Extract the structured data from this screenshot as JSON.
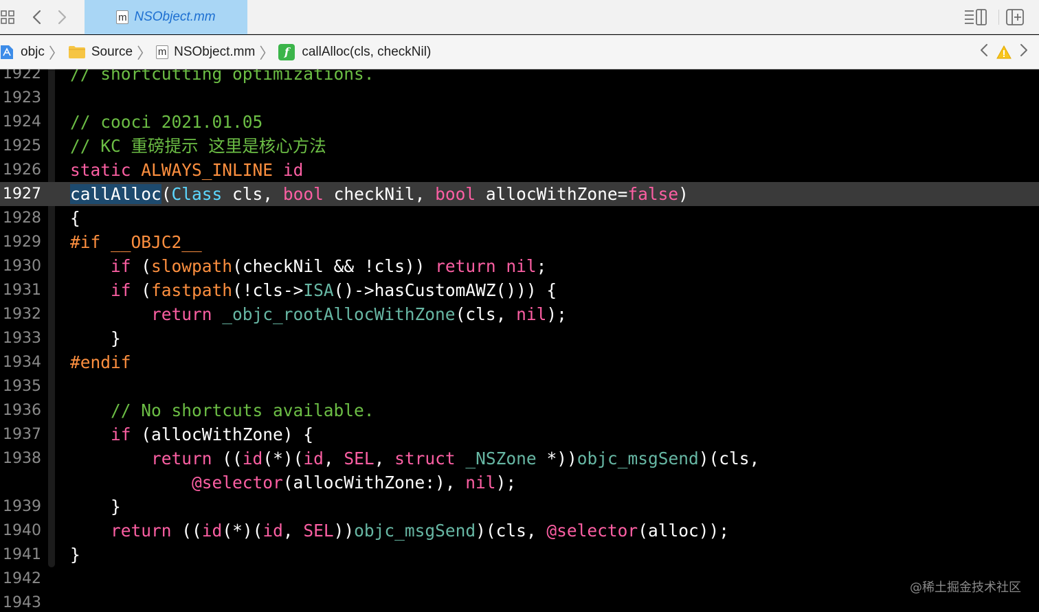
{
  "tab": {
    "label": "NSObject.mm",
    "file_badge": "m"
  },
  "breadcrumb": {
    "project": "objc",
    "folder": "Source",
    "file": "NSObject.mm",
    "file_badge": "m",
    "symbol": "callAlloc(cls, checkNil)",
    "symbol_badge": "f"
  },
  "colors": {
    "comment": "#6cbe45",
    "keyword": "#fc5fa3",
    "preprocessor": "#fd8f3f",
    "type": "#5dd8ff",
    "function": "#67b7a4"
  },
  "current_line": "1927",
  "lines": [
    {
      "num": "1922",
      "tokens": [
        [
          "cm",
          "// shortcutting optimizations."
        ]
      ]
    },
    {
      "num": "1923",
      "tokens": []
    },
    {
      "num": "1924",
      "tokens": [
        [
          "cm",
          "// cooci 2021.01.05"
        ]
      ]
    },
    {
      "num": "1925",
      "tokens": [
        [
          "cm",
          "// KC 重磅提示 这里是核心方法"
        ]
      ]
    },
    {
      "num": "1926",
      "tokens": [
        [
          "kw",
          "static"
        ],
        [
          "pl",
          " "
        ],
        [
          "pp",
          "ALWAYS_INLINE"
        ],
        [
          "pl",
          " "
        ],
        [
          "kw",
          "id"
        ]
      ]
    },
    {
      "num": "1927",
      "tokens": [
        [
          "hl",
          "callAlloc"
        ],
        [
          "pl",
          "("
        ],
        [
          "ty",
          "Class"
        ],
        [
          "pl",
          " cls, "
        ],
        [
          "kw",
          "bool"
        ],
        [
          "pl",
          " checkNil, "
        ],
        [
          "kw",
          "bool"
        ],
        [
          "pl",
          " allocWithZone="
        ],
        [
          "kw",
          "false"
        ],
        [
          "pl",
          ")"
        ]
      ]
    },
    {
      "num": "1928",
      "tokens": [
        [
          "pl",
          "{"
        ]
      ]
    },
    {
      "num": "1929",
      "tokens": [
        [
          "pp",
          "#if __OBJC2__"
        ]
      ]
    },
    {
      "num": "1930",
      "tokens": [
        [
          "pl",
          "    "
        ],
        [
          "kw",
          "if"
        ],
        [
          "pl",
          " ("
        ],
        [
          "pp",
          "slowpath"
        ],
        [
          "pl",
          "(checkNil && !cls)) "
        ],
        [
          "kw",
          "return"
        ],
        [
          "pl",
          " "
        ],
        [
          "kw",
          "nil"
        ],
        [
          "pl",
          ";"
        ]
      ]
    },
    {
      "num": "1931",
      "tokens": [
        [
          "pl",
          "    "
        ],
        [
          "kw",
          "if"
        ],
        [
          "pl",
          " ("
        ],
        [
          "pp",
          "fastpath"
        ],
        [
          "pl",
          "(!cls->"
        ],
        [
          "fn",
          "ISA"
        ],
        [
          "pl",
          "()->hasCustomAWZ())) {"
        ]
      ]
    },
    {
      "num": "1932",
      "tokens": [
        [
          "pl",
          "        "
        ],
        [
          "kw",
          "return"
        ],
        [
          "pl",
          " "
        ],
        [
          "fn",
          "_objc_rootAllocWithZone"
        ],
        [
          "pl",
          "(cls, "
        ],
        [
          "kw",
          "nil"
        ],
        [
          "pl",
          ");"
        ]
      ]
    },
    {
      "num": "1933",
      "tokens": [
        [
          "pl",
          "    }"
        ]
      ]
    },
    {
      "num": "1934",
      "tokens": [
        [
          "pp",
          "#endif"
        ]
      ]
    },
    {
      "num": "1935",
      "tokens": []
    },
    {
      "num": "1936",
      "tokens": [
        [
          "pl",
          "    "
        ],
        [
          "cm",
          "// No shortcuts available."
        ]
      ]
    },
    {
      "num": "1937",
      "tokens": [
        [
          "pl",
          "    "
        ],
        [
          "kw",
          "if"
        ],
        [
          "pl",
          " (allocWithZone) {"
        ]
      ]
    },
    {
      "num": "1938",
      "tokens": [
        [
          "pl",
          "        "
        ],
        [
          "kw",
          "return"
        ],
        [
          "pl",
          " (("
        ],
        [
          "kw",
          "id"
        ],
        [
          "pl",
          "(*)("
        ],
        [
          "kw",
          "id"
        ],
        [
          "pl",
          ", "
        ],
        [
          "kw",
          "SEL"
        ],
        [
          "pl",
          ", "
        ],
        [
          "kw",
          "struct"
        ],
        [
          "pl",
          " "
        ],
        [
          "fn",
          "_NSZone"
        ],
        [
          "pl",
          " *))"
        ],
        [
          "fn",
          "objc_msgSend"
        ],
        [
          "pl",
          ")(cls,"
        ]
      ]
    },
    {
      "num": "",
      "tokens": [
        [
          "pl",
          "            "
        ],
        [
          "kw",
          "@selector"
        ],
        [
          "pl",
          "(allocWithZone:), "
        ],
        [
          "kw",
          "nil"
        ],
        [
          "pl",
          ");"
        ]
      ]
    },
    {
      "num": "1939",
      "tokens": [
        [
          "pl",
          "    }"
        ]
      ]
    },
    {
      "num": "1940",
      "tokens": [
        [
          "pl",
          "    "
        ],
        [
          "kw",
          "return"
        ],
        [
          "pl",
          " (("
        ],
        [
          "kw",
          "id"
        ],
        [
          "pl",
          "(*)("
        ],
        [
          "kw",
          "id"
        ],
        [
          "pl",
          ", "
        ],
        [
          "kw",
          "SEL"
        ],
        [
          "pl",
          "))"
        ],
        [
          "fn",
          "objc_msgSend"
        ],
        [
          "pl",
          ")(cls, "
        ],
        [
          "kw",
          "@selector"
        ],
        [
          "pl",
          "(alloc));"
        ]
      ]
    },
    {
      "num": "1941",
      "tokens": [
        [
          "pl",
          "}"
        ]
      ]
    },
    {
      "num": "1942",
      "tokens": []
    },
    {
      "num": "1943",
      "tokens": []
    }
  ],
  "watermark": "@稀土掘金技术社区"
}
